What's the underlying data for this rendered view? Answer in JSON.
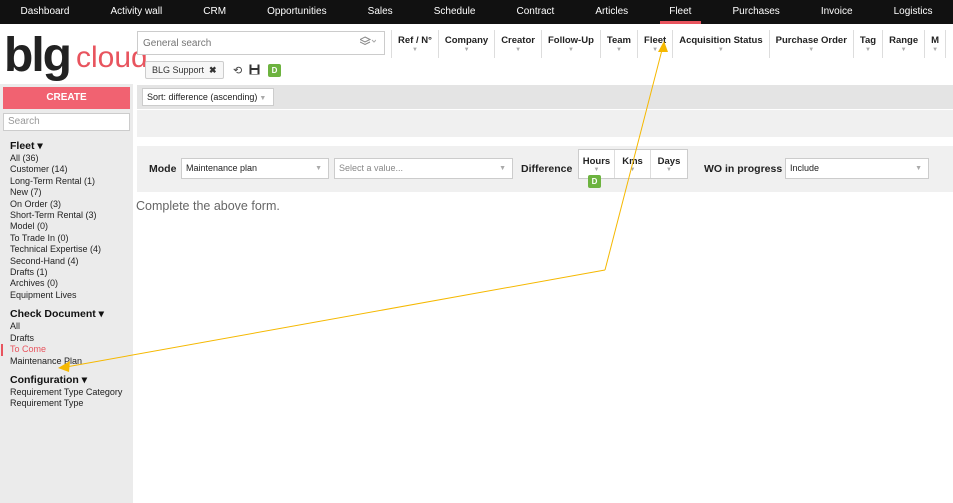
{
  "nav": {
    "items": [
      "Dashboard",
      "Activity wall",
      "CRM",
      "Opportunities",
      "Sales",
      "Schedule",
      "Contract",
      "Articles",
      "Fleet",
      "Purchases",
      "Invoice",
      "Logistics"
    ],
    "active": "Fleet"
  },
  "logo": {
    "part1": "blg",
    "part2": "cloud"
  },
  "search": {
    "placeholder": "General search"
  },
  "filter_chip": {
    "label": "BLG Support",
    "remove": "✖"
  },
  "badge": "D",
  "columns": [
    "Ref / N°",
    "Company",
    "Creator",
    "Follow-Up",
    "Team",
    "Fleet",
    "Acquisition Status",
    "Purchase Order",
    "Tag",
    "Range",
    "M"
  ],
  "sidebar": {
    "create_label": "CREATE",
    "search_placeholder": "Search",
    "fleet": {
      "title": "Fleet ▾",
      "items": [
        "All (36)",
        "Customer (14)",
        "Long-Term Rental (1)",
        "New (7)",
        "On Order (3)",
        "Short-Term Rental (3)",
        "Model (0)",
        "To Trade In (0)",
        "Technical Expertise (4)",
        "Second-Hand (4)",
        "Drafts (1)",
        "Archives (0)",
        "Equipment Lives"
      ]
    },
    "check_document": {
      "title": "Check Document ▾",
      "items": [
        "All",
        "Drafts",
        "To Come",
        "Maintenance Plan"
      ],
      "active": "To Come"
    },
    "configuration": {
      "title": "Configuration ▾",
      "items": [
        "Requirement Type Category",
        "Requirement Type"
      ]
    }
  },
  "sort": {
    "label": "Sort: difference (ascending)"
  },
  "form": {
    "mode_label": "Mode",
    "mode_value": "Maintenance plan",
    "value_placeholder": "Select a value...",
    "difference_label": "Difference",
    "units": [
      "Hours",
      "Kms",
      "Days"
    ],
    "wo_label": "WO in progress",
    "wo_value": "Include"
  },
  "hint": "Complete the above form.",
  "colors": {
    "accent": "#e8545e",
    "create": "#f16271",
    "badge": "#6db33f",
    "annotation": "#f5b800"
  },
  "icons": {
    "search_stack": "layers-icon",
    "history": "history-icon",
    "save": "save-icon"
  }
}
